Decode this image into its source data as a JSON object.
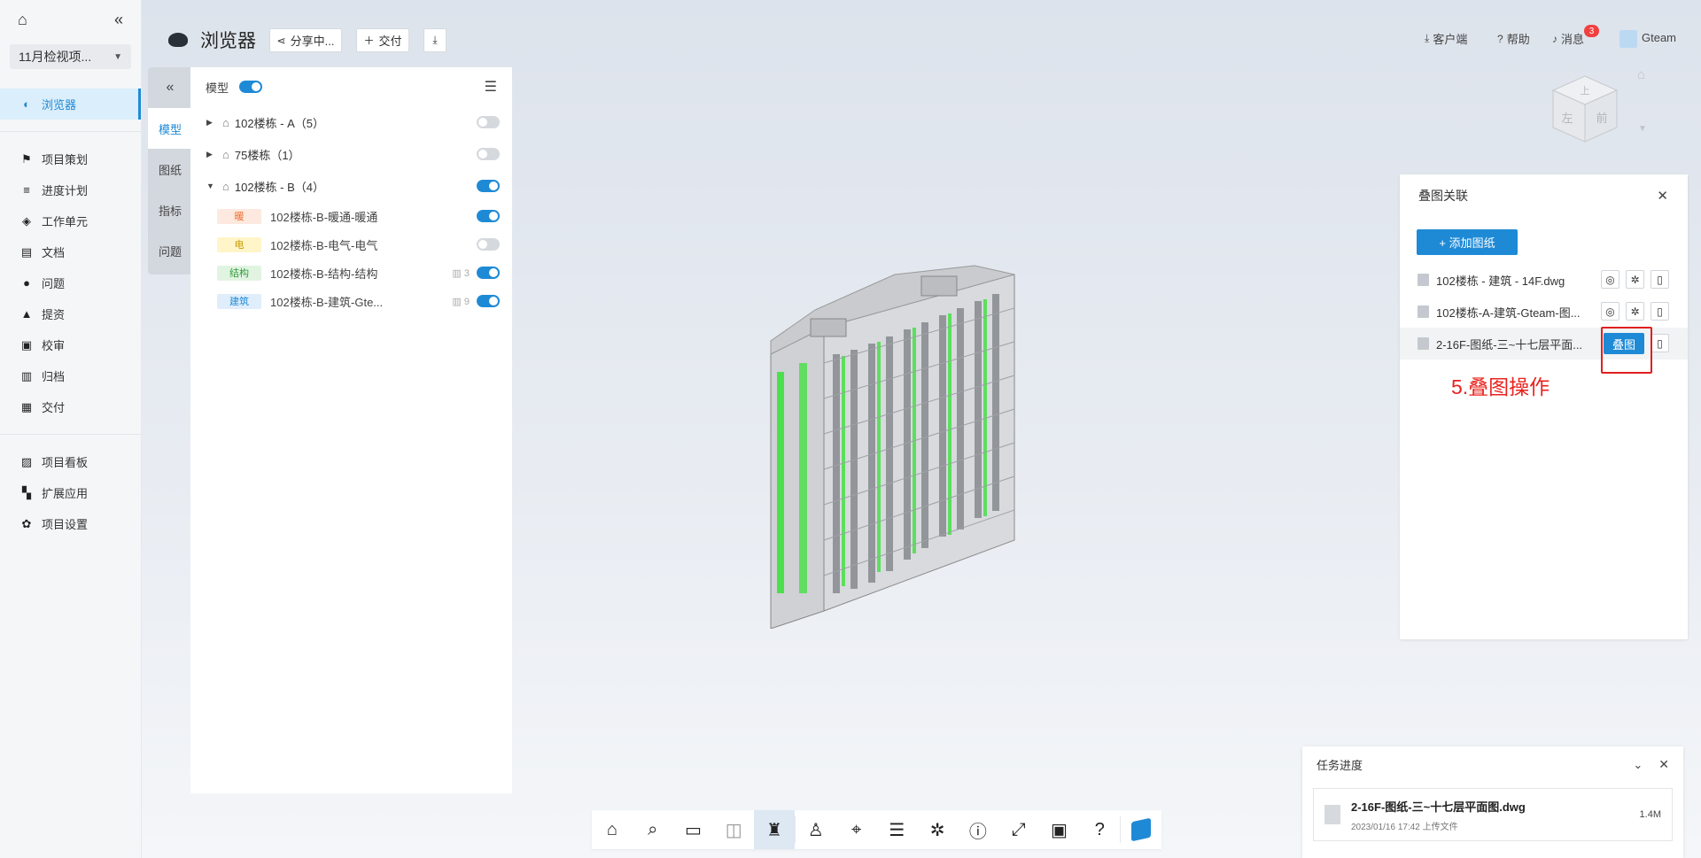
{
  "sidebar": {
    "project_name": "11月检视项...",
    "items": [
      {
        "label": "浏览器",
        "icon": "globe-icon",
        "glyph": "◐",
        "active": true
      },
      {
        "label": "项目策划",
        "icon": "flag-icon",
        "glyph": "⚑"
      },
      {
        "label": "进度计划",
        "icon": "gantt-icon",
        "glyph": "≡"
      },
      {
        "label": "工作单元",
        "icon": "cube-icon",
        "glyph": "◈"
      },
      {
        "label": "文档",
        "icon": "document-icon",
        "glyph": "▤"
      },
      {
        "label": "问题",
        "icon": "question-circle-icon",
        "glyph": "●"
      },
      {
        "label": "提资",
        "icon": "upload-file-icon",
        "glyph": "▲"
      },
      {
        "label": "校审",
        "icon": "review-icon",
        "glyph": "▣"
      },
      {
        "label": "归档",
        "icon": "archive-icon",
        "glyph": "▥"
      },
      {
        "label": "交付",
        "icon": "briefcase-icon",
        "glyph": "▦"
      },
      {
        "label": "项目看板",
        "icon": "dashboard-icon",
        "glyph": "▨"
      },
      {
        "label": "扩展应用",
        "icon": "apps-icon",
        "glyph": "▚"
      },
      {
        "label": "项目设置",
        "icon": "gear-icon",
        "glyph": "✿"
      }
    ]
  },
  "header": {
    "title": "浏览器",
    "share_label": "分享中...",
    "deliver_label": "交付",
    "client_label": "客户端",
    "help_label": "帮助",
    "messages_label": "消息",
    "messages_badge": "3",
    "user_name": "Gteam"
  },
  "tabs": {
    "items": [
      "模型",
      "图纸",
      "指标",
      "问题"
    ],
    "active": "模型"
  },
  "model_panel": {
    "header_label": "模型",
    "groups": [
      {
        "name": "102楼栋 - A（5）",
        "expanded": false,
        "on": false
      },
      {
        "name": "75楼栋（1）",
        "expanded": false,
        "on": false
      },
      {
        "name": "102楼栋 - B（4）",
        "expanded": true,
        "on": true
      }
    ],
    "models": [
      {
        "tag": "暖",
        "tag_color": "#f06b2f",
        "tag_bg": "#fde9df",
        "name": "102楼栋-B-暖通-暖通",
        "count": "",
        "on": true
      },
      {
        "tag": "电",
        "tag_color": "#c99a00",
        "tag_bg": "#fff5c9",
        "name": "102楼栋-B-电气-电气",
        "count": "",
        "on": false
      },
      {
        "tag": "结构",
        "tag_color": "#2f9c3a",
        "tag_bg": "#e1f4e1",
        "name": "102楼栋-B-结构-结构",
        "count": "3",
        "on": true
      },
      {
        "tag": "建筑",
        "tag_color": "#1e8ad6",
        "tag_bg": "#e0eefb",
        "name": "102楼栋-B-建筑-Gte...",
        "count": "9",
        "on": true
      }
    ]
  },
  "overlay_panel": {
    "title": "叠图关联",
    "add_label": "+ 添加图纸",
    "files": [
      {
        "name": "102楼栋 - 建筑 - 14F.dwg",
        "selected": false
      },
      {
        "name": "102楼栋-A-建筑-Gteam-图...",
        "selected": false
      },
      {
        "name": "2-16F-图纸-三~十七层平面...",
        "selected": true
      }
    ],
    "overlay_button": "叠图",
    "annotation": "5.叠图操作"
  },
  "task_panel": {
    "title": "任务进度",
    "file_name": "2-16F-图纸-三~十七层平面图.dwg",
    "meta": "2023/01/16 17:42 上传文件",
    "size": "1.4M"
  },
  "viewcube": {
    "top": "上",
    "left": "左",
    "front": "前"
  },
  "colors": {
    "accent": "#1e8ad6",
    "annotation": "#e8231e"
  }
}
